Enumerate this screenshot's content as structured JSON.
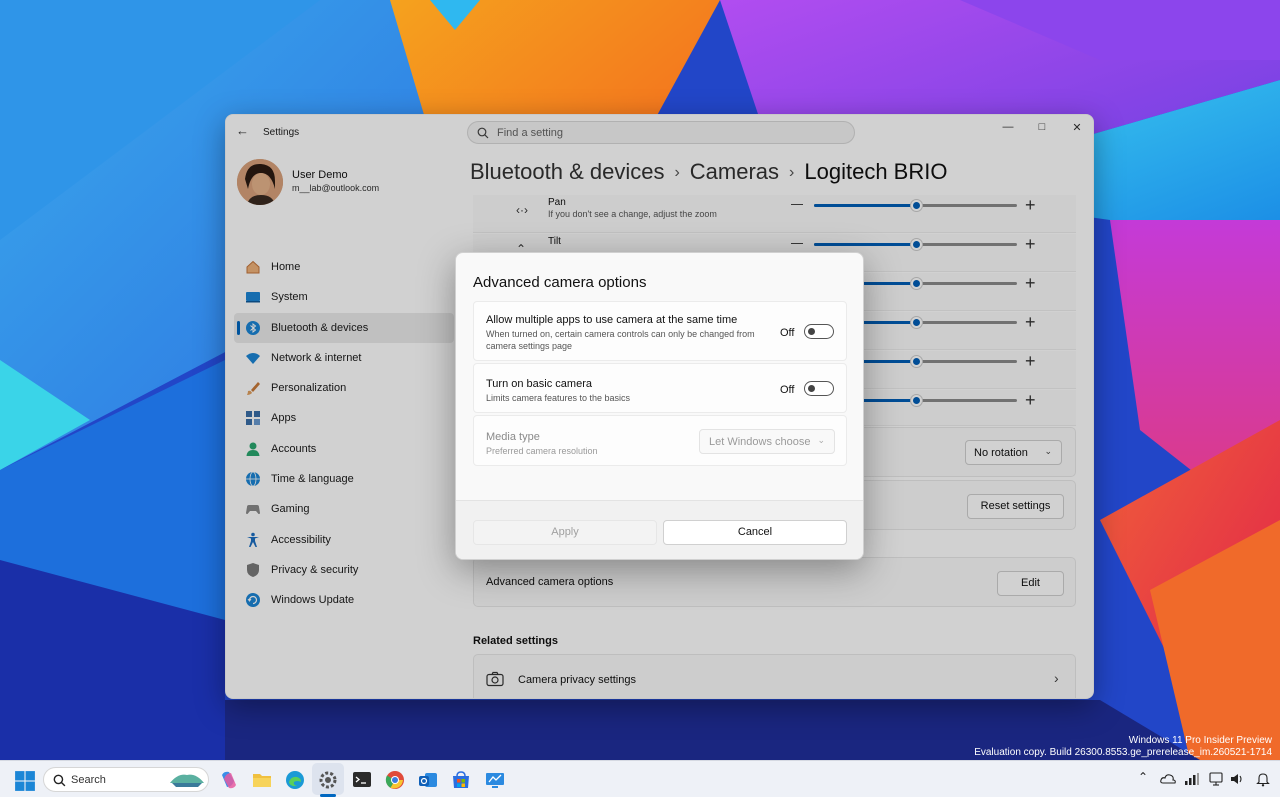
{
  "window": {
    "app_title": "Settings",
    "search_placeholder": "Find a setting"
  },
  "user": {
    "name": "User Demo",
    "email": "m__lab@outlook.com"
  },
  "nav": [
    {
      "label": "Home",
      "icon": "home-icon"
    },
    {
      "label": "System",
      "icon": "system-icon"
    },
    {
      "label": "Bluetooth & devices",
      "icon": "bluetooth-icon",
      "active": true
    },
    {
      "label": "Network & internet",
      "icon": "wifi-icon"
    },
    {
      "label": "Personalization",
      "icon": "brush-icon"
    },
    {
      "label": "Apps",
      "icon": "apps-icon"
    },
    {
      "label": "Accounts",
      "icon": "accounts-icon"
    },
    {
      "label": "Time & language",
      "icon": "globe-icon"
    },
    {
      "label": "Gaming",
      "icon": "gamepad-icon"
    },
    {
      "label": "Accessibility",
      "icon": "accessibility-icon"
    },
    {
      "label": "Privacy & security",
      "icon": "shield-icon"
    },
    {
      "label": "Windows Update",
      "icon": "update-icon"
    }
  ],
  "breadcrumb": {
    "level1": "Bluetooth & devices",
    "level2": "Cameras",
    "current": "Logitech BRIO"
  },
  "sliders": [
    {
      "label": "Pan",
      "desc": "If you don't see a change, adjust the zoom",
      "value": 0.5
    },
    {
      "label": "Tilt",
      "desc": "",
      "value": 0.5
    },
    {
      "label": "",
      "desc": "",
      "value": 0.5
    },
    {
      "label": "",
      "desc": "",
      "value": 0.5
    },
    {
      "label": "",
      "desc": "",
      "value": 0.5
    },
    {
      "label": "",
      "desc": "",
      "value": 0.5
    }
  ],
  "rotation": {
    "value": "No rotation"
  },
  "reset": {
    "button": "Reset settings"
  },
  "advanced": {
    "label": "Advanced camera options",
    "button": "Edit"
  },
  "related": {
    "title": "Related settings",
    "privacy": "Camera privacy settings"
  },
  "dialog": {
    "title": "Advanced camera options",
    "multi": {
      "title": "Allow multiple apps to use camera at the same time",
      "desc": "When turned on, certain camera controls can only be changed from camera settings page",
      "state": "Off"
    },
    "basic": {
      "title": "Turn on basic camera",
      "desc": "Limits camera features to the basics",
      "state": "Off"
    },
    "media": {
      "title": "Media type",
      "desc": "Preferred camera resolution",
      "value": "Let Windows choose"
    },
    "apply": "Apply",
    "cancel": "Cancel"
  },
  "watermark": {
    "line1": "Windows 11 Pro Insider Preview",
    "line2": "Evaluation copy. Build 26300.8553.ge_prerelease_im.260521-1714"
  },
  "taskbar": {
    "search_placeholder": "Search"
  }
}
